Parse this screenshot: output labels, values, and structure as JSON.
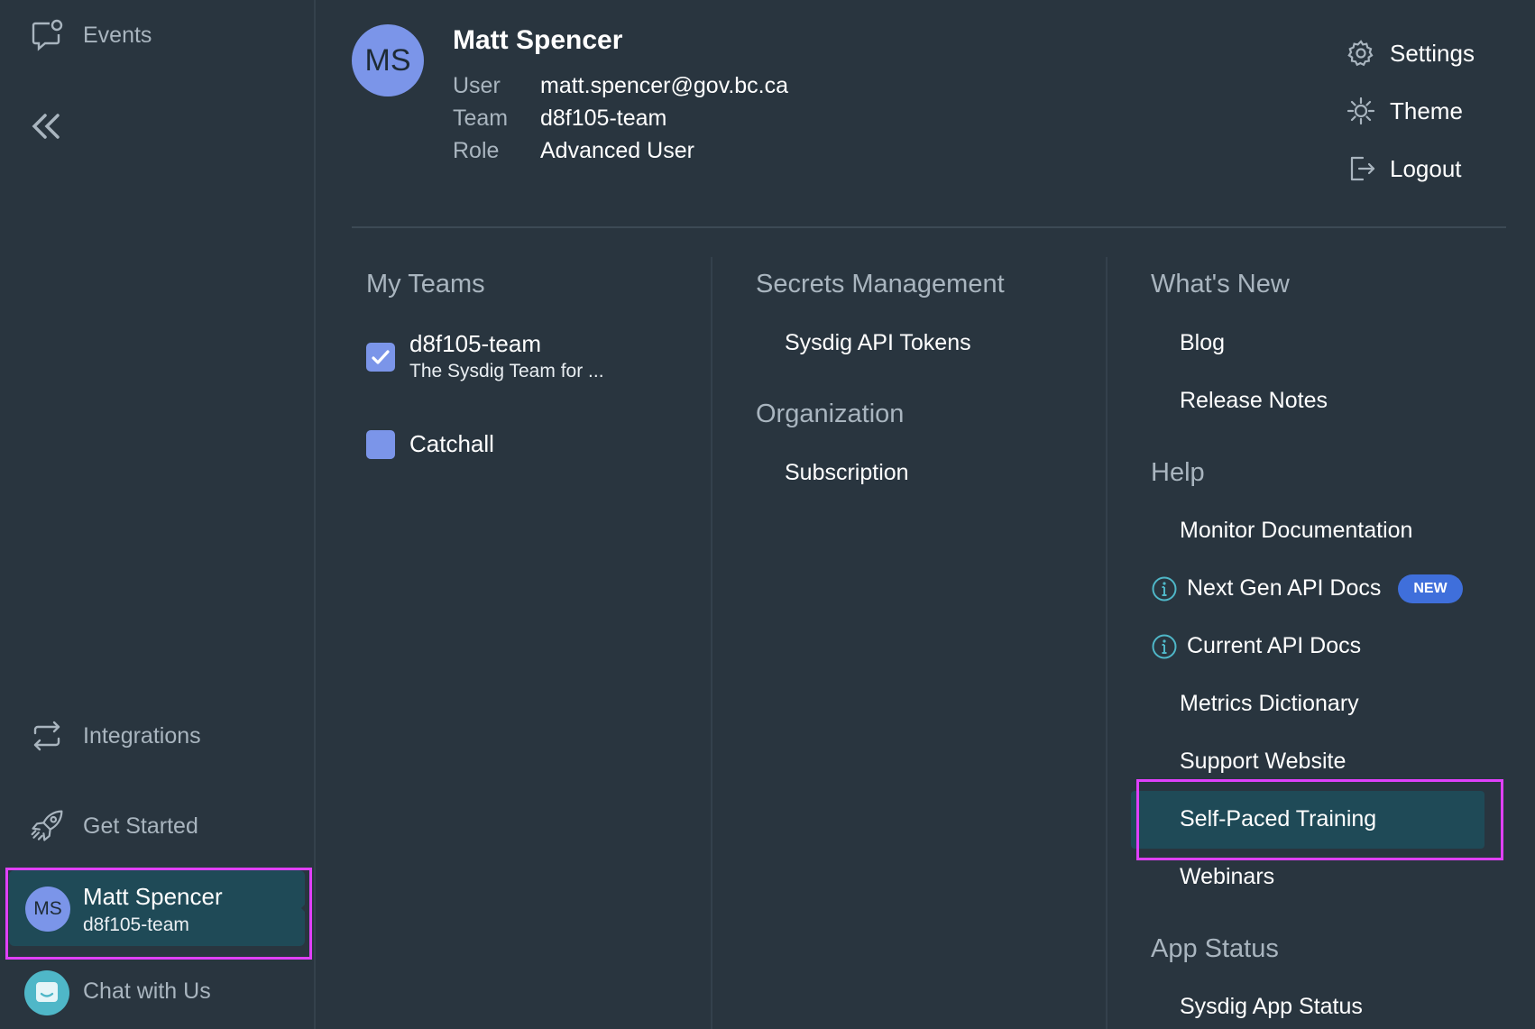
{
  "sidebar": {
    "events": "Events",
    "integrations": "Integrations",
    "get_started": "Get Started",
    "user": {
      "initials": "MS",
      "name": "Matt Spencer",
      "team": "d8f105-team"
    },
    "chat": "Chat with Us"
  },
  "profile": {
    "initials": "MS",
    "name": "Matt Spencer",
    "user_label": "User",
    "user_value": "matt.spencer@gov.bc.ca",
    "team_label": "Team",
    "team_value": "d8f105-team",
    "role_label": "Role",
    "role_value": "Advanced User"
  },
  "actions": {
    "settings": "Settings",
    "theme": "Theme",
    "logout": "Logout"
  },
  "my_teams": {
    "title": "My Teams",
    "teams": [
      {
        "name": "d8f105-team",
        "desc": "The Sysdig Team for ...",
        "checked": true
      },
      {
        "name": "Catchall",
        "checked": false
      }
    ]
  },
  "secrets": {
    "title": "Secrets Management",
    "api_tokens": "Sysdig API Tokens"
  },
  "organization": {
    "title": "Organization",
    "subscription": "Subscription"
  },
  "whats_new": {
    "title": "What's New",
    "blog": "Blog",
    "release_notes": "Release Notes"
  },
  "help": {
    "title": "Help",
    "monitor_docs": "Monitor Documentation",
    "next_gen_api": "Next Gen API Docs",
    "new_badge": "NEW",
    "current_api": "Current API Docs",
    "metrics_dictionary": "Metrics Dictionary",
    "support_website": "Support Website",
    "self_paced": "Self-Paced Training",
    "webinars": "Webinars"
  },
  "app_status": {
    "title": "App Status",
    "sysdig_status": "Sysdig App Status"
  },
  "colors": {
    "accent": "#7b95e9",
    "highlight": "#e040fb",
    "selected_bg": "#1f4a57",
    "badge": "#3f6fdb"
  }
}
